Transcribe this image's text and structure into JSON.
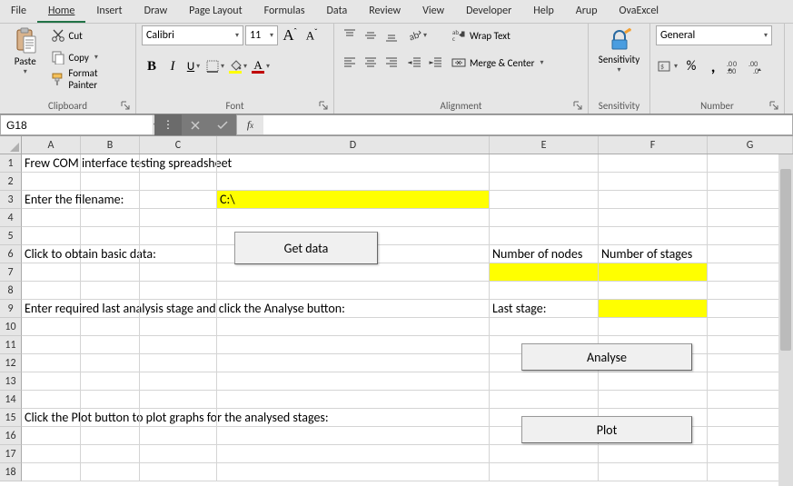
{
  "menu": {
    "tabs": [
      "File",
      "Home",
      "Insert",
      "Draw",
      "Page Layout",
      "Formulas",
      "Data",
      "Review",
      "View",
      "Developer",
      "Help",
      "Arup",
      "OvaExcel"
    ],
    "active_idx": 1
  },
  "ribbon": {
    "clipboard": {
      "label": "Clipboard",
      "paste": "Paste",
      "cut": "Cut",
      "copy": "Copy",
      "format_painter": "Format Painter"
    },
    "font": {
      "label": "Font",
      "family": "Calibri",
      "size": "11",
      "grow_hint": "A",
      "shrink_hint": "A"
    },
    "alignment": {
      "label": "Alignment",
      "wrap": "Wrap Text",
      "merge": "Merge & Center"
    },
    "sensitivity": {
      "label": "Sensitivity",
      "btn": "Sensitivity"
    },
    "number": {
      "label": "Number",
      "format": "General"
    }
  },
  "fbar": {
    "namebox": "G18",
    "formula": ""
  },
  "grid": {
    "columns": [
      "A",
      "B",
      "C",
      "D",
      "E",
      "F",
      "G"
    ],
    "rows": 18,
    "cells": {
      "A1": "Frew COM interface testing spreadsheet",
      "A3": "Enter the filename:",
      "D3": "C:\\",
      "A6": "Click to obtain basic data:",
      "E6": "Number of nodes",
      "F6": "Number of stages",
      "A9": "Enter required last analysis stage and click the Analyse button:",
      "E9": "Last stage:",
      "A15": "Click the Plot button to plot graphs for the analysed stages:"
    },
    "buttons": {
      "get_data": "Get data",
      "analyse": "Analyse",
      "plot": "Plot"
    },
    "yellow_cells": [
      "D3",
      "E7",
      "F7",
      "F9"
    ]
  }
}
